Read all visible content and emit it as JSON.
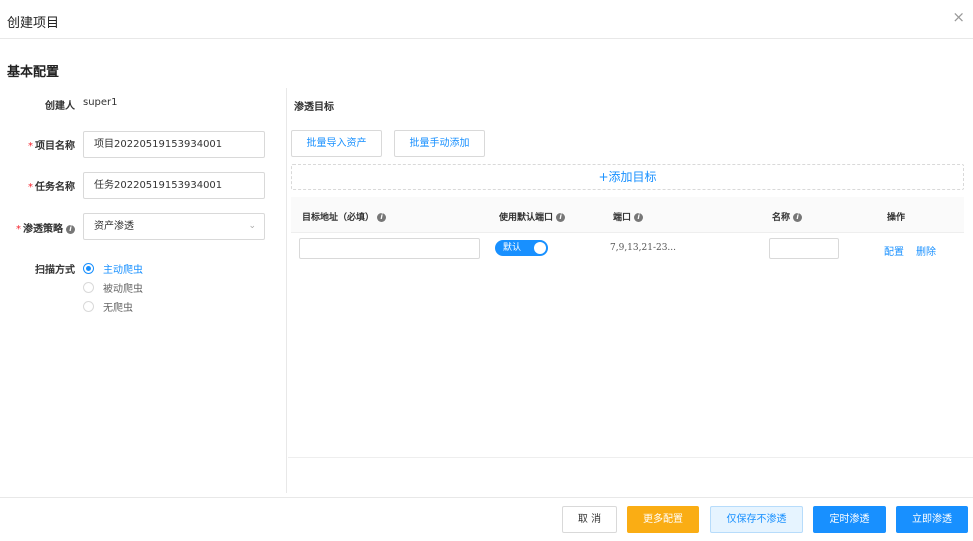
{
  "dialog": {
    "title": "创建项目",
    "close_glyph": "×"
  },
  "section_title": "基本配置",
  "form": {
    "creator_label": "创建人",
    "creator_value": "super1",
    "required_mark": "*",
    "project_name_label": "项目名称",
    "project_name_value": "项目20220519153934001",
    "task_name_label": "任务名称",
    "task_name_value": "任务20220519153934001",
    "strategy_label": "渗透策略",
    "strategy_value": "资产渗透",
    "scan_mode_label": "扫描方式",
    "scan_options": [
      {
        "label": "主动爬虫",
        "checked": true
      },
      {
        "label": "被动爬虫",
        "checked": false
      },
      {
        "label": "无爬虫",
        "checked": false
      }
    ]
  },
  "targets": {
    "title": "渗透目标",
    "batch_import_label": "批量导入资产",
    "batch_manual_label": "批量手动添加",
    "add_target_label": "+添加目标",
    "columns": {
      "address": "目标地址（必填）",
      "use_default_port": "使用默认端口",
      "port": "端口",
      "name": "名称",
      "actions": "操作"
    },
    "rows": [
      {
        "address": "",
        "switch_label": "默认",
        "switch_on": true,
        "ports": "7,9,13,21-23...",
        "name": "",
        "action_config": "配置",
        "action_delete": "删除"
      }
    ]
  },
  "footer": {
    "cancel": "取 消",
    "more_config": "更多配置",
    "save_only": "仅保存不渗透",
    "scheduled": "定时渗透",
    "immediate": "立即渗透"
  },
  "colors": {
    "primary": "#1890ff",
    "warning": "#faad14",
    "required": "#f5222d"
  },
  "icons": {
    "info": "info-circle-icon",
    "select_arrow": "chevron-down-icon",
    "close": "close-icon"
  }
}
